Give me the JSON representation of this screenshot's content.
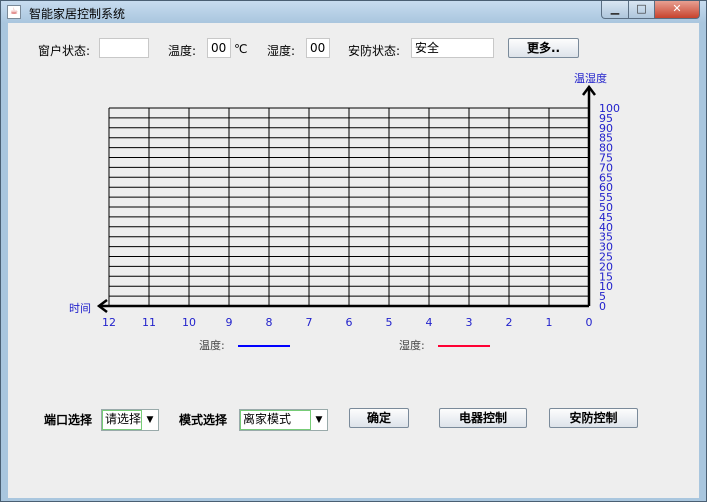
{
  "window": {
    "title": "智能家居控制系统"
  },
  "status": {
    "window_label": "窗户状态:",
    "window_value": "",
    "temp_label": "温度:",
    "temp_value": "00",
    "temp_unit": "℃",
    "humidity_label": "湿度:",
    "humidity_value": "00",
    "security_label": "安防状态:",
    "security_value": "安全",
    "more_button": "更多.."
  },
  "chart_data": {
    "type": "line",
    "y_axis_label": "温湿度",
    "x_axis_label": "时间",
    "y_ticks": [
      "100",
      "95",
      "90",
      "85",
      "80",
      "75",
      "70",
      "65",
      "60",
      "55",
      "50",
      "45",
      "40",
      "35",
      "30",
      "25",
      "20",
      "15",
      "10",
      "5",
      "0"
    ],
    "x_ticks": [
      "12",
      "11",
      "10",
      "9",
      "8",
      "7",
      "6",
      "5",
      "4",
      "3",
      "2",
      "1",
      "0"
    ],
    "ylim": [
      0,
      100
    ],
    "xlim": [
      12,
      0
    ],
    "grid": true,
    "legend": [
      {
        "name": "温度:",
        "color": "#0000ff"
      },
      {
        "name": "湿度:",
        "color": "#ff0033"
      }
    ],
    "series": []
  },
  "controls": {
    "port_label": "端口选择",
    "port_selected": "请选择",
    "mode_label": "模式选择",
    "mode_selected": "离家模式",
    "confirm_button": "确定",
    "appliance_button": "电器控制",
    "security_button": "安防控制"
  }
}
